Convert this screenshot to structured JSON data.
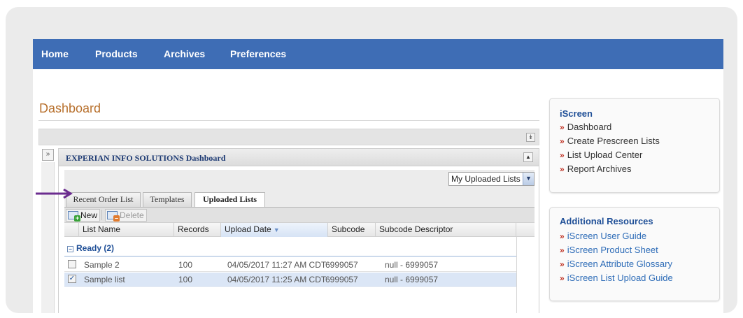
{
  "navbar": {
    "items": [
      {
        "label": "Home"
      },
      {
        "label": "Products"
      },
      {
        "label": "Archives"
      },
      {
        "label": "Preferences"
      }
    ]
  },
  "page": {
    "title": "Dashboard"
  },
  "panel": {
    "title": "EXPERIAN INFO SOLUTIONS Dashboard",
    "view_select": "My Uploaded Lists",
    "tabs": [
      {
        "label": "Recent Order List"
      },
      {
        "label": "Templates"
      },
      {
        "label": "Uploaded Lists",
        "active": true
      }
    ],
    "toolbar": {
      "new_label": "New",
      "delete_label": "Delete"
    },
    "columns": [
      "List Name",
      "Records",
      "Upload Date",
      "Subcode",
      "Subcode Descriptor"
    ],
    "group_label": "Ready (2)",
    "rows": [
      {
        "checked": false,
        "name": "Sample 2",
        "records": "100",
        "date": "04/05/2017 11:27 AM CDT",
        "subcode": "6999057",
        "descriptor": "null - 6999057"
      },
      {
        "checked": true,
        "name": "Sample list",
        "records": "100",
        "date": "04/05/2017 11:25 AM CDT",
        "subcode": "6999057",
        "descriptor": "null - 6999057"
      }
    ]
  },
  "sidebar": {
    "iscreen": {
      "title": "iScreen",
      "links": [
        "Dashboard",
        "Create Prescreen Lists",
        "List Upload Center",
        "Report Archives"
      ]
    },
    "resources": {
      "title": "Additional Resources",
      "links": [
        "iScreen User Guide",
        "iScreen Product Sheet",
        "iScreen Attribute Glossary",
        "iScreen List Upload Guide"
      ]
    }
  },
  "icons": {
    "bullet": "»",
    "collapse_all": "double-chevron-down-icon",
    "side_toggle": "double-chevron-right-icon",
    "panel_collapse": "triangle-up-icon",
    "dropdown": "chevron-down-icon",
    "sort": "sort-descending-icon",
    "group_toggle": "minus-box-icon",
    "arrow": "arrow-right-icon"
  },
  "colors": {
    "nav_bg": "#3e6db5",
    "title": "#b8712e",
    "link_blue": "#1f4f97",
    "bullet_red": "#c0392b",
    "arrow_purple": "#6b2c8f",
    "selected_row": "#dbe6f6"
  }
}
